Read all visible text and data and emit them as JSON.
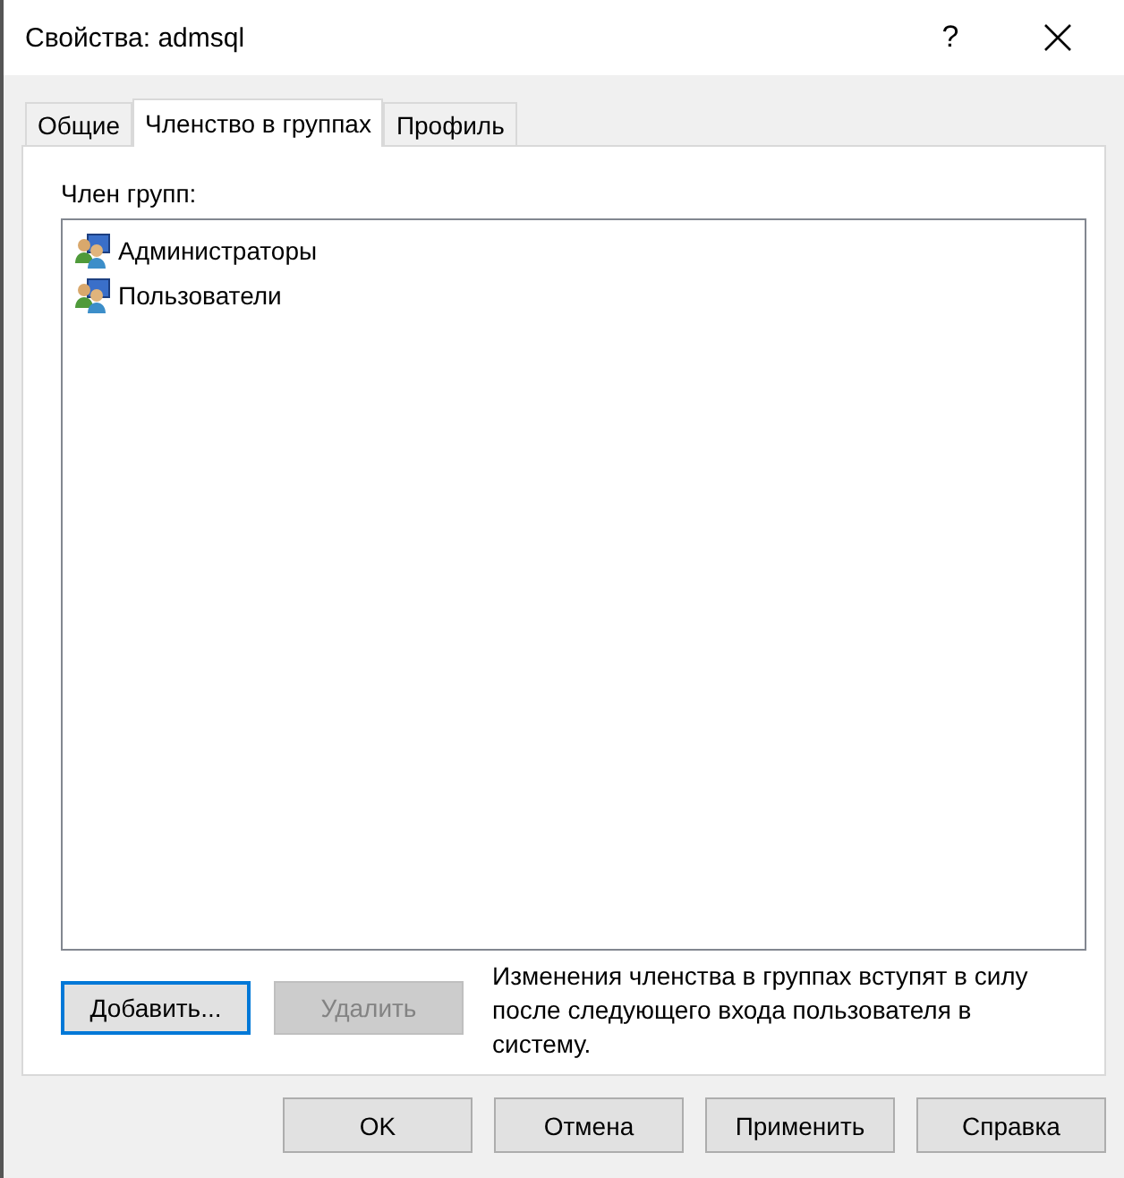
{
  "window": {
    "title": "Свойства: admsql",
    "help": "?"
  },
  "tabs": [
    {
      "label": "Общие",
      "selected": false
    },
    {
      "label": "Членство в группах",
      "selected": true
    },
    {
      "label": "Профиль",
      "selected": false
    }
  ],
  "groups": {
    "label": "Член групп:",
    "items": [
      {
        "name": "Администраторы"
      },
      {
        "name": "Пользователи"
      }
    ]
  },
  "actions": [
    {
      "label": "Добавить...",
      "disabled": false,
      "focused": true
    },
    {
      "label": "Удалить",
      "disabled": true,
      "focused": false
    }
  ],
  "note": "Изменения членства в группах вступят в силу после следующего входа пользователя в систему.",
  "buttons": [
    "OK",
    "Отмена",
    "Применить",
    "Справка"
  ]
}
